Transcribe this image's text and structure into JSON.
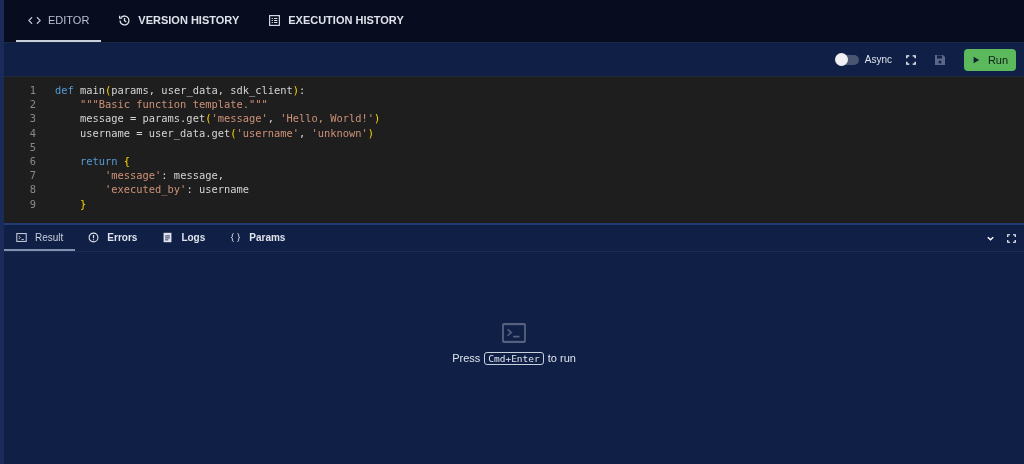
{
  "tabs": [
    {
      "label": "EDITOR",
      "kind": "code",
      "selected": true
    },
    {
      "label": "VERSION HISTORY",
      "kind": "history",
      "selected": false
    },
    {
      "label": "EXECUTION HISTORY",
      "kind": "list",
      "selected": false
    }
  ],
  "toolbar": {
    "async": {
      "label": "Async",
      "on": false
    },
    "run_label": "Run"
  },
  "code": [
    {
      "number": "1",
      "tokens": [
        {
          "kind": "kw",
          "text": "def "
        },
        {
          "kind": "plain",
          "text": "main"
        },
        {
          "kind": "br",
          "text": "("
        },
        {
          "kind": "plain",
          "text": "params, user_data, sdk_client"
        },
        {
          "kind": "br",
          "text": ")"
        },
        {
          "kind": "plain",
          "text": ":"
        }
      ]
    },
    {
      "number": "2",
      "tokens": [
        {
          "kind": "str",
          "text": "    \"\"\"Basic function template.\"\"\""
        }
      ]
    },
    {
      "number": "3",
      "tokens": [
        {
          "kind": "plain",
          "text": "    message = params.get"
        },
        {
          "kind": "br",
          "text": "("
        },
        {
          "kind": "str",
          "text": "'message'"
        },
        {
          "kind": "plain",
          "text": ", "
        },
        {
          "kind": "str",
          "text": "'Hello, World!'"
        },
        {
          "kind": "br",
          "text": ")"
        }
      ]
    },
    {
      "number": "4",
      "tokens": [
        {
          "kind": "plain",
          "text": "    username = user_data.get"
        },
        {
          "kind": "br",
          "text": "("
        },
        {
          "kind": "str",
          "text": "'username'"
        },
        {
          "kind": "plain",
          "text": ", "
        },
        {
          "kind": "str",
          "text": "'unknown'"
        },
        {
          "kind": "br",
          "text": ")"
        }
      ]
    },
    {
      "number": "5"
    },
    {
      "number": "6",
      "tokens": [
        {
          "kind": "kw",
          "text": "    return "
        },
        {
          "kind": "br",
          "text": "{"
        }
      ]
    },
    {
      "number": "7",
      "tokens": [
        {
          "kind": "str",
          "text": "        'message'"
        },
        {
          "kind": "plain",
          "text": ": message,"
        }
      ]
    },
    {
      "number": "8",
      "tokens": [
        {
          "kind": "str",
          "text": "        'executed_by'"
        },
        {
          "kind": "plain",
          "text": ": username"
        }
      ]
    },
    {
      "number": "9",
      "tokens": [
        {
          "kind": "br",
          "text": "    }"
        }
      ]
    }
  ],
  "output_tabs": [
    {
      "label": "Result",
      "kind": "terminal",
      "selected": true
    },
    {
      "label": "Errors",
      "kind": "alert",
      "selected": false
    },
    {
      "label": "Logs",
      "kind": "doc",
      "selected": false
    },
    {
      "label": "Params",
      "kind": "braces",
      "selected": false
    }
  ],
  "empty_state": {
    "before": "Press",
    "key": "Cmd+Enter",
    "after": "to run"
  }
}
